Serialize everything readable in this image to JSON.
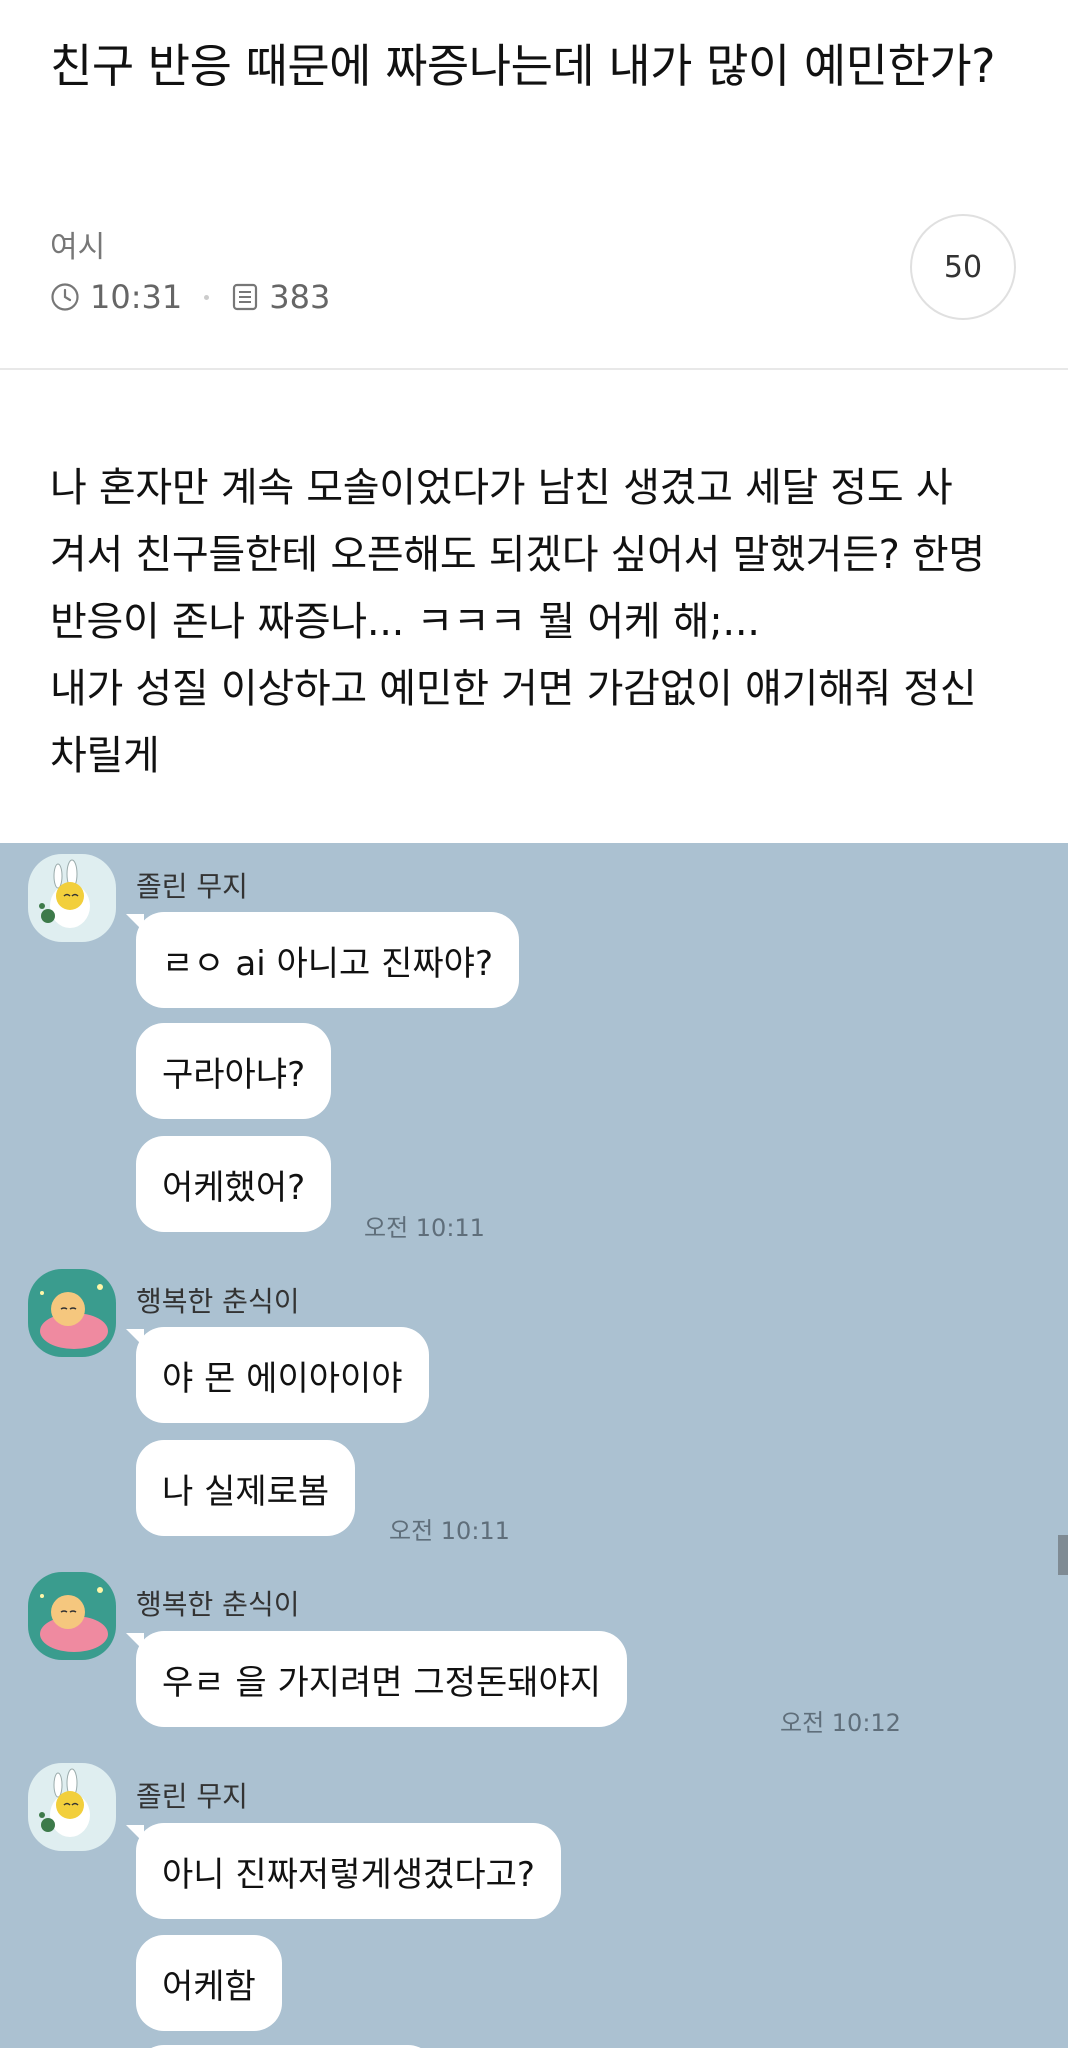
{
  "post": {
    "title": "친구 반응 때문에 짜증나는데 내가 많이 예민한가?",
    "author": "여시",
    "time": "10:31",
    "views": "383",
    "comment_count": "50",
    "body": "나 혼자만 계속 모솔이었다가 남친 생겼고 세달 정도 사\n겨서 친구들한테 오픈해도 되겠다 싶어서 말했거든? 한명\n반응이 존나 짜증나... ㅋㅋㅋ 뭘 어케 해;...\n내가 성질 이상하고 예민한 거면 가감없이 얘기해줘 정신\n차릴게"
  },
  "chat": {
    "background": "#abc1d1",
    "messages": [
      {
        "sender": "졸린 무지",
        "avatar_icon": "muzi-avatar-icon",
        "bubbles": [
          "ㄹㅇ ai 아니고 진짜야?",
          "구라아냐?",
          "어케했어?"
        ],
        "time": "오전 10:11"
      },
      {
        "sender": "행복한 춘식이",
        "avatar_icon": "choonsik-avatar-icon",
        "bubbles": [
          "야 몬 에이아이야",
          "나 실제로봄"
        ],
        "time": "오전 10:11"
      },
      {
        "sender": "행복한 춘식이",
        "avatar_icon": "choonsik-avatar-icon",
        "bubbles": [
          "우ㄹ          을 가지려면 그정돈돼야지"
        ],
        "time": "오전 10:12"
      },
      {
        "sender": "졸린 무지",
        "avatar_icon": "muzi-avatar-icon",
        "bubbles": [
          "아니 진짜저렇게생겼다고?",
          "어케함"
        ]
      }
    ]
  },
  "icons": {
    "clock": "clock-icon",
    "views": "document-icon"
  }
}
